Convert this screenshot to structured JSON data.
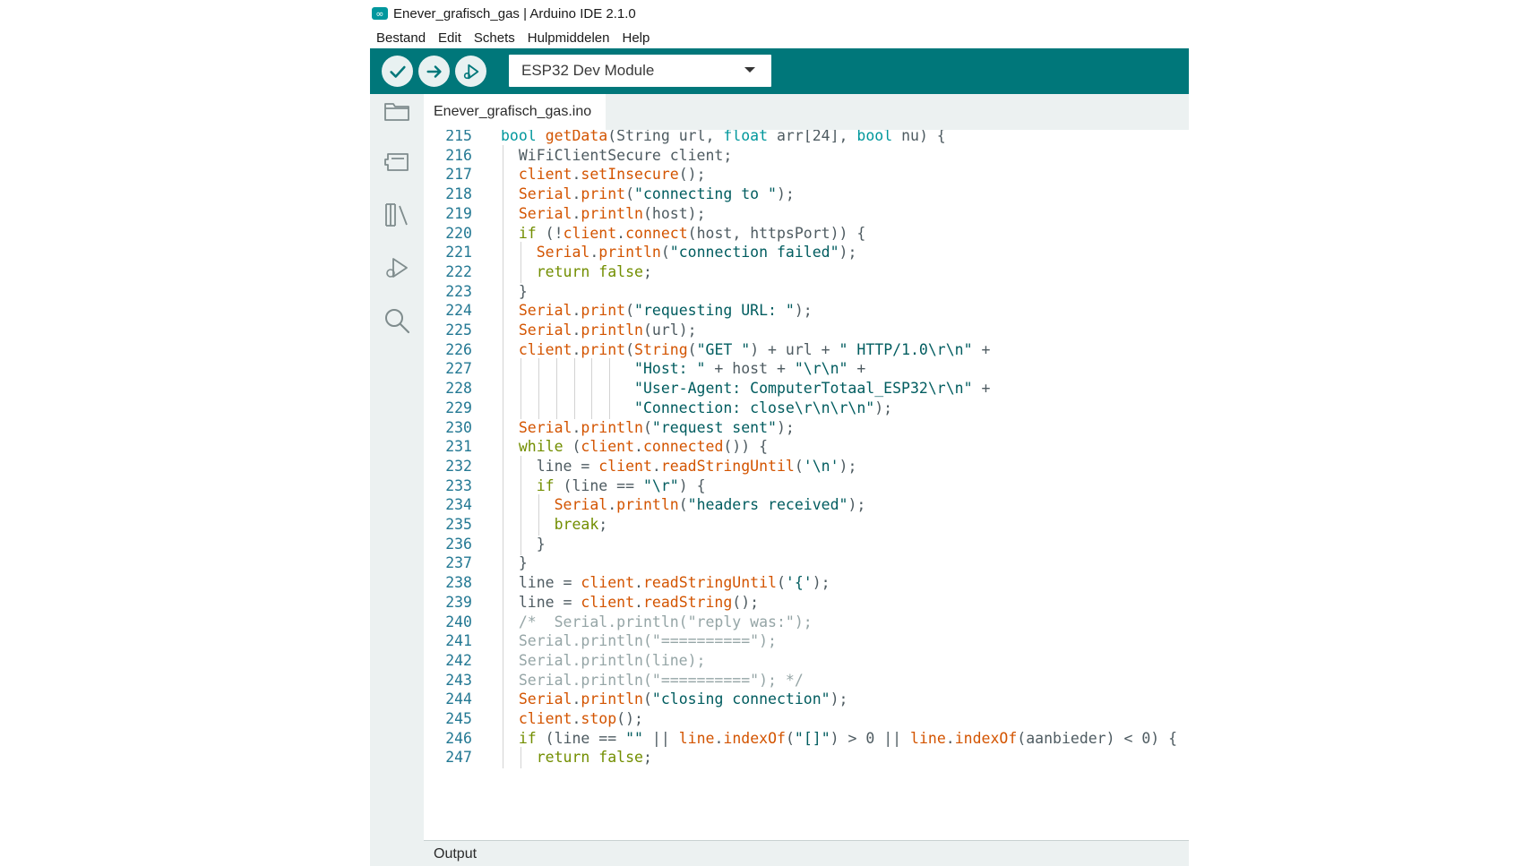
{
  "window": {
    "title": "Enever_grafisch_gas | Arduino IDE 2.1.0",
    "logo_glyph": "∞"
  },
  "menu": [
    "Bestand",
    "Edit",
    "Schets",
    "Hulpmiddelen",
    "Help"
  ],
  "toolbar": {
    "verify_icon": "check-icon",
    "upload_icon": "arrow-right-icon",
    "debug_icon": "debug-icon",
    "board": "ESP32 Dev Module"
  },
  "sidebar": [
    "folder-icon",
    "board-manager-icon",
    "library-icon",
    "debug-icon",
    "search-icon"
  ],
  "tab": {
    "filename": "Enever_grafisch_gas.ino"
  },
  "colors": {
    "toolbar": "#00777a",
    "type": "#00979c",
    "function": "#d35400",
    "string": "#005c5f",
    "keyword": "#728e00",
    "comment": "#95a5a6",
    "line_number": "#237893"
  },
  "editor": {
    "lines": [
      {
        "n": "215",
        "segs": [
          [
            "type",
            "bool"
          ],
          [
            "t",
            " "
          ],
          [
            "fn",
            "getData"
          ],
          [
            "t",
            "(String url, "
          ],
          [
            "type",
            "float"
          ],
          [
            "t",
            " arr[24], "
          ],
          [
            "type",
            "bool"
          ],
          [
            "t",
            " nu) {"
          ]
        ]
      },
      {
        "n": "216",
        "segs": [
          [
            "t",
            "  WiFiClientSecure client;"
          ]
        ]
      },
      {
        "n": "217",
        "segs": [
          [
            "t",
            "  "
          ],
          [
            "fn",
            "client"
          ],
          [
            "t",
            "."
          ],
          [
            "fn",
            "setInsecure"
          ],
          [
            "t",
            "();"
          ]
        ]
      },
      {
        "n": "218",
        "segs": [
          [
            "t",
            "  "
          ],
          [
            "fn",
            "Serial"
          ],
          [
            "t",
            "."
          ],
          [
            "fn",
            "print"
          ],
          [
            "t",
            "("
          ],
          [
            "str",
            "\"connecting to \""
          ],
          [
            "t",
            ");"
          ]
        ]
      },
      {
        "n": "219",
        "segs": [
          [
            "t",
            "  "
          ],
          [
            "fn",
            "Serial"
          ],
          [
            "t",
            "."
          ],
          [
            "fn",
            "println"
          ],
          [
            "t",
            "(host);"
          ]
        ]
      },
      {
        "n": "220",
        "segs": [
          [
            "t",
            "  "
          ],
          [
            "kw",
            "if"
          ],
          [
            "t",
            " (!"
          ],
          [
            "fn",
            "client"
          ],
          [
            "t",
            "."
          ],
          [
            "fn",
            "connect"
          ],
          [
            "t",
            "(host, httpsPort)) {"
          ]
        ]
      },
      {
        "n": "221",
        "segs": [
          [
            "t",
            "    "
          ],
          [
            "fn",
            "Serial"
          ],
          [
            "t",
            "."
          ],
          [
            "fn",
            "println"
          ],
          [
            "t",
            "("
          ],
          [
            "str",
            "\"connection failed\""
          ],
          [
            "t",
            ");"
          ]
        ]
      },
      {
        "n": "222",
        "segs": [
          [
            "t",
            "    "
          ],
          [
            "kw",
            "return"
          ],
          [
            "t",
            " "
          ],
          [
            "kw",
            "false"
          ],
          [
            "t",
            ";"
          ]
        ]
      },
      {
        "n": "223",
        "segs": [
          [
            "t",
            "  }"
          ]
        ]
      },
      {
        "n": "224",
        "segs": [
          [
            "t",
            "  "
          ],
          [
            "fn",
            "Serial"
          ],
          [
            "t",
            "."
          ],
          [
            "fn",
            "print"
          ],
          [
            "t",
            "("
          ],
          [
            "str",
            "\"requesting URL: \""
          ],
          [
            "t",
            ");"
          ]
        ]
      },
      {
        "n": "225",
        "segs": [
          [
            "t",
            "  "
          ],
          [
            "fn",
            "Serial"
          ],
          [
            "t",
            "."
          ],
          [
            "fn",
            "println"
          ],
          [
            "t",
            "(url);"
          ]
        ]
      },
      {
        "n": "226",
        "segs": [
          [
            "t",
            "  "
          ],
          [
            "fn",
            "client"
          ],
          [
            "t",
            "."
          ],
          [
            "fn",
            "print"
          ],
          [
            "t",
            "("
          ],
          [
            "fn",
            "String"
          ],
          [
            "t",
            "("
          ],
          [
            "str",
            "\"GET \""
          ],
          [
            "t",
            ") + url + "
          ],
          [
            "str",
            "\" HTTP/1.0\\r\\n\""
          ],
          [
            "t",
            " +"
          ]
        ]
      },
      {
        "n": "227",
        "segs": [
          [
            "t",
            "               "
          ],
          [
            "str",
            "\"Host: \""
          ],
          [
            "t",
            " + host + "
          ],
          [
            "str",
            "\"\\r\\n\""
          ],
          [
            "t",
            " +"
          ]
        ]
      },
      {
        "n": "228",
        "segs": [
          [
            "t",
            "               "
          ],
          [
            "str",
            "\"User-Agent: ComputerTotaal_ESP32\\r\\n\""
          ],
          [
            "t",
            " +"
          ]
        ]
      },
      {
        "n": "229",
        "segs": [
          [
            "t",
            "               "
          ],
          [
            "str",
            "\"Connection: close\\r\\n\\r\\n\""
          ],
          [
            "t",
            ");"
          ]
        ]
      },
      {
        "n": "230",
        "segs": [
          [
            "t",
            "  "
          ],
          [
            "fn",
            "Serial"
          ],
          [
            "t",
            "."
          ],
          [
            "fn",
            "println"
          ],
          [
            "t",
            "("
          ],
          [
            "str",
            "\"request sent\""
          ],
          [
            "t",
            ");"
          ]
        ]
      },
      {
        "n": "231",
        "segs": [
          [
            "t",
            "  "
          ],
          [
            "kw",
            "while"
          ],
          [
            "t",
            " ("
          ],
          [
            "fn",
            "client"
          ],
          [
            "t",
            "."
          ],
          [
            "fn",
            "connected"
          ],
          [
            "t",
            "()) {"
          ]
        ]
      },
      {
        "n": "232",
        "segs": [
          [
            "t",
            "    line = "
          ],
          [
            "fn",
            "client"
          ],
          [
            "t",
            "."
          ],
          [
            "fn",
            "readStringUntil"
          ],
          [
            "t",
            "("
          ],
          [
            "str",
            "'\\n'"
          ],
          [
            "t",
            ");"
          ]
        ]
      },
      {
        "n": "233",
        "segs": [
          [
            "t",
            "    "
          ],
          [
            "kw",
            "if"
          ],
          [
            "t",
            " (line == "
          ],
          [
            "str",
            "\"\\r\""
          ],
          [
            "t",
            ") {"
          ]
        ]
      },
      {
        "n": "234",
        "segs": [
          [
            "t",
            "      "
          ],
          [
            "fn",
            "Serial"
          ],
          [
            "t",
            "."
          ],
          [
            "fn",
            "println"
          ],
          [
            "t",
            "("
          ],
          [
            "str",
            "\"headers received\""
          ],
          [
            "t",
            ");"
          ]
        ]
      },
      {
        "n": "235",
        "segs": [
          [
            "t",
            "      "
          ],
          [
            "kw",
            "break"
          ],
          [
            "t",
            ";"
          ]
        ]
      },
      {
        "n": "236",
        "segs": [
          [
            "t",
            "    }"
          ]
        ]
      },
      {
        "n": "237",
        "segs": [
          [
            "t",
            "  }"
          ]
        ]
      },
      {
        "n": "238",
        "segs": [
          [
            "t",
            "  line = "
          ],
          [
            "fn",
            "client"
          ],
          [
            "t",
            "."
          ],
          [
            "fn",
            "readStringUntil"
          ],
          [
            "t",
            "("
          ],
          [
            "str",
            "'{'"
          ],
          [
            "t",
            ");"
          ]
        ]
      },
      {
        "n": "239",
        "segs": [
          [
            "t",
            "  line = "
          ],
          [
            "fn",
            "client"
          ],
          [
            "t",
            "."
          ],
          [
            "fn",
            "readString"
          ],
          [
            "t",
            "();"
          ]
        ]
      },
      {
        "n": "240",
        "segs": [
          [
            "t",
            "  "
          ],
          [
            "cm",
            "/*  Serial.println(\"reply was:\");"
          ]
        ]
      },
      {
        "n": "241",
        "segs": [
          [
            "t",
            "  "
          ],
          [
            "cm",
            "Serial.println(\"==========\");"
          ]
        ]
      },
      {
        "n": "242",
        "segs": [
          [
            "t",
            "  "
          ],
          [
            "cm",
            "Serial.println(line);"
          ]
        ]
      },
      {
        "n": "243",
        "segs": [
          [
            "t",
            "  "
          ],
          [
            "cm",
            "Serial.println(\"==========\"); */"
          ]
        ]
      },
      {
        "n": "244",
        "segs": [
          [
            "t",
            "  "
          ],
          [
            "fn",
            "Serial"
          ],
          [
            "t",
            "."
          ],
          [
            "fn",
            "println"
          ],
          [
            "t",
            "("
          ],
          [
            "str",
            "\"closing connection\""
          ],
          [
            "t",
            ");"
          ]
        ]
      },
      {
        "n": "245",
        "segs": [
          [
            "t",
            "  "
          ],
          [
            "fn",
            "client"
          ],
          [
            "t",
            "."
          ],
          [
            "fn",
            "stop"
          ],
          [
            "t",
            "();"
          ]
        ]
      },
      {
        "n": "246",
        "segs": [
          [
            "t",
            "  "
          ],
          [
            "kw",
            "if"
          ],
          [
            "t",
            " (line == "
          ],
          [
            "str",
            "\"\""
          ],
          [
            "t",
            " || "
          ],
          [
            "fn",
            "line"
          ],
          [
            "t",
            "."
          ],
          [
            "fn",
            "indexOf"
          ],
          [
            "t",
            "("
          ],
          [
            "str",
            "\"[]\""
          ],
          [
            "t",
            ") > 0 || "
          ],
          [
            "fn",
            "line"
          ],
          [
            "t",
            "."
          ],
          [
            "fn",
            "indexOf"
          ],
          [
            "t",
            "(aanbieder) < 0) {"
          ]
        ]
      },
      {
        "n": "247",
        "segs": [
          [
            "t",
            "    "
          ],
          [
            "kw",
            "return"
          ],
          [
            "t",
            " "
          ],
          [
            "kw",
            "false"
          ],
          [
            "t",
            ";"
          ]
        ]
      }
    ]
  },
  "output": {
    "label": "Output"
  }
}
